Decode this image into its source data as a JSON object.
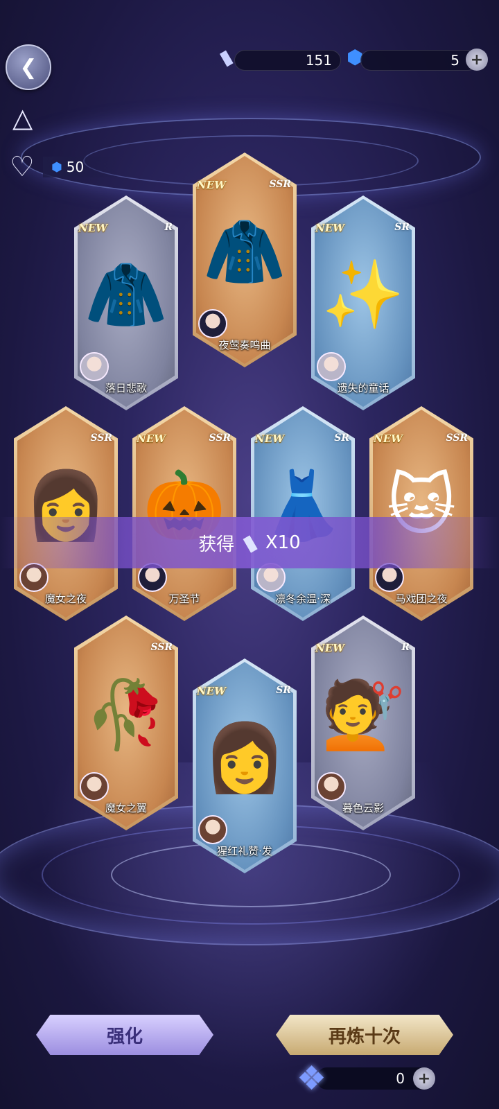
{
  "currency": {
    "tickets": "151",
    "crystals": "5",
    "heart_crystals": "50"
  },
  "cards": [
    {
      "id": "c1",
      "name": "落日悲歌",
      "rarity": "R",
      "is_new": true,
      "new_label": "NEW",
      "style": "gray",
      "art_icon": "jacket-icon"
    },
    {
      "id": "c2",
      "name": "夜莺奏鸣曲",
      "rarity": "SSR",
      "is_new": true,
      "new_label": "NEW",
      "style": "gold",
      "art_icon": "coat-icon"
    },
    {
      "id": "c3",
      "name": "遗失的童话",
      "rarity": "SR",
      "is_new": true,
      "new_label": "NEW",
      "style": "blue",
      "art_icon": "sparkle-ring-icon"
    },
    {
      "id": "c4",
      "name": "魔女之夜",
      "rarity": "SSR",
      "is_new": false,
      "new_label": "",
      "style": "gold",
      "art_icon": "hairstyle-icon"
    },
    {
      "id": "c5",
      "name": "万圣节",
      "rarity": "SSR",
      "is_new": true,
      "new_label": "NEW",
      "style": "gold",
      "art_icon": "pumpkin-tree-icon"
    },
    {
      "id": "c6",
      "name": "凛冬余温·深",
      "rarity": "SR",
      "is_new": true,
      "new_label": "NEW",
      "style": "blue",
      "art_icon": "dress-icon"
    },
    {
      "id": "c7",
      "name": "马戏团之夜",
      "rarity": "SSR",
      "is_new": true,
      "new_label": "NEW",
      "style": "gold",
      "art_icon": "cat-mask-icon"
    },
    {
      "id": "c8",
      "name": "魔女之翼",
      "rarity": "SSR",
      "is_new": false,
      "new_label": "",
      "style": "gold",
      "art_icon": "wings-icon"
    },
    {
      "id": "c9",
      "name": "猩红礼赞·发",
      "rarity": "SR",
      "is_new": true,
      "new_label": "NEW",
      "style": "blue",
      "art_icon": "long-hair-icon"
    },
    {
      "id": "c10",
      "name": "暮色云影",
      "rarity": "R",
      "is_new": true,
      "new_label": "NEW",
      "style": "gray",
      "art_icon": "short-hair-icon"
    }
  ],
  "gain_banner": {
    "label": "获得",
    "amount": "X10"
  },
  "buttons": {
    "enhance": "强化",
    "refine_again": "再炼十次"
  },
  "refine_cost": "0"
}
